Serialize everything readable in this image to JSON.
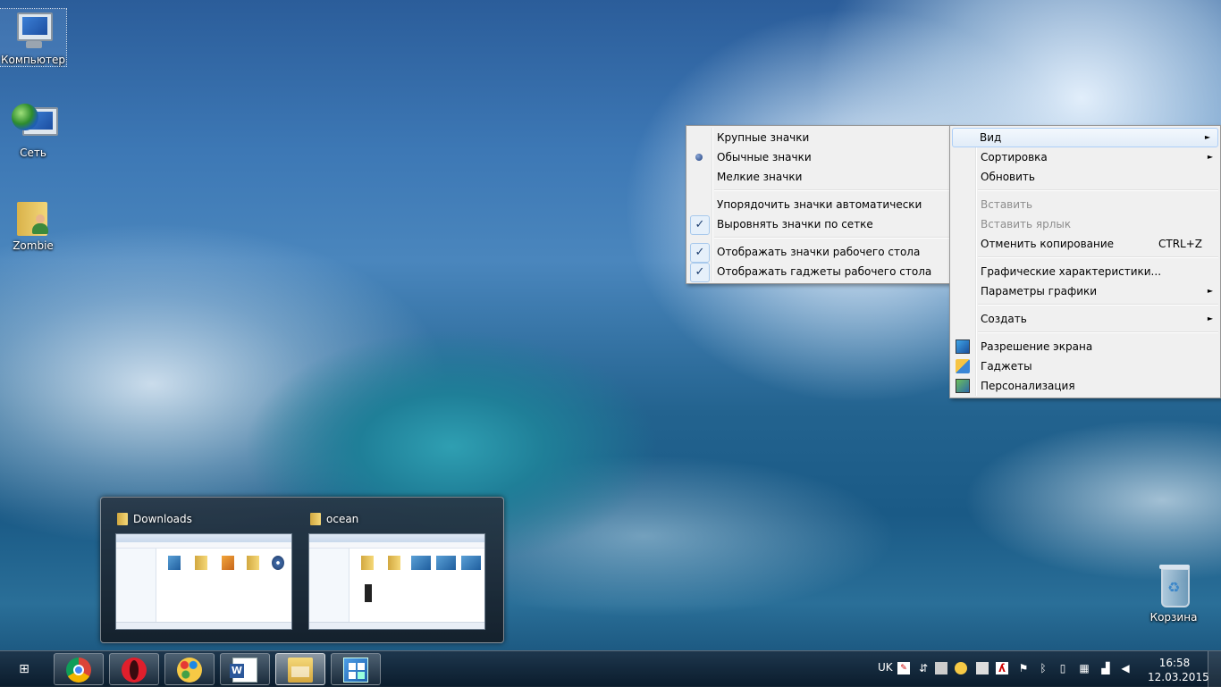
{
  "desktop": {
    "icons": [
      {
        "label": "Компьютер"
      },
      {
        "label": "Сеть"
      },
      {
        "label": "Zombie"
      },
      {
        "label": "Корзина"
      }
    ]
  },
  "view_submenu": {
    "items": [
      {
        "label": "Крупные значки"
      },
      {
        "label": "Обычные значки",
        "state": "selected"
      },
      {
        "label": "Мелкие значки"
      },
      {
        "label": "Упорядочить значки автоматически"
      },
      {
        "label": "Выровнять значки по сетке",
        "state": "checked"
      },
      {
        "label": "Отображать значки рабочего стола",
        "state": "checked"
      },
      {
        "label": "Отображать гаджеты  рабочего стола",
        "state": "checked"
      }
    ]
  },
  "context_menu": {
    "items": [
      {
        "label": "Вид"
      },
      {
        "label": "Сортировка"
      },
      {
        "label": "Обновить"
      },
      {
        "label": "Вставить",
        "state": "disabled"
      },
      {
        "label": "Вставить ярлык",
        "state": "disabled"
      },
      {
        "label": "Отменить копирование",
        "shortcut": "CTRL+Z"
      },
      {
        "label": "Графические характеристики..."
      },
      {
        "label": "Параметры графики"
      },
      {
        "label": "Создать"
      },
      {
        "label": "Разрешение экрана",
        "icon": "screen-resolution-icon"
      },
      {
        "label": "Гаджеты",
        "icon": "gadgets-icon"
      },
      {
        "label": "Персонализация",
        "icon": "personalization-icon"
      }
    ],
    "submenu_arrow": "►",
    "check_glyph": "✓"
  },
  "preview": {
    "windows": [
      {
        "title": "Downloads"
      },
      {
        "title": "ocean"
      }
    ]
  },
  "taskbar": {
    "start_glyph": "⊞",
    "apps": [
      {
        "icon": "chrome-icon"
      },
      {
        "icon": "opera-icon"
      },
      {
        "icon": "paint-icon"
      },
      {
        "icon": "word-icon"
      },
      {
        "icon": "explorer-icon"
      },
      {
        "icon": "control-panel-icon"
      }
    ],
    "language": "UK",
    "time": "16:58",
    "date": "12.03.2015"
  },
  "colors": {
    "menu_bg": "#f0f0f0",
    "menu_highlight": "#e1ecf8",
    "disabled_text": "#8d8d8d"
  }
}
